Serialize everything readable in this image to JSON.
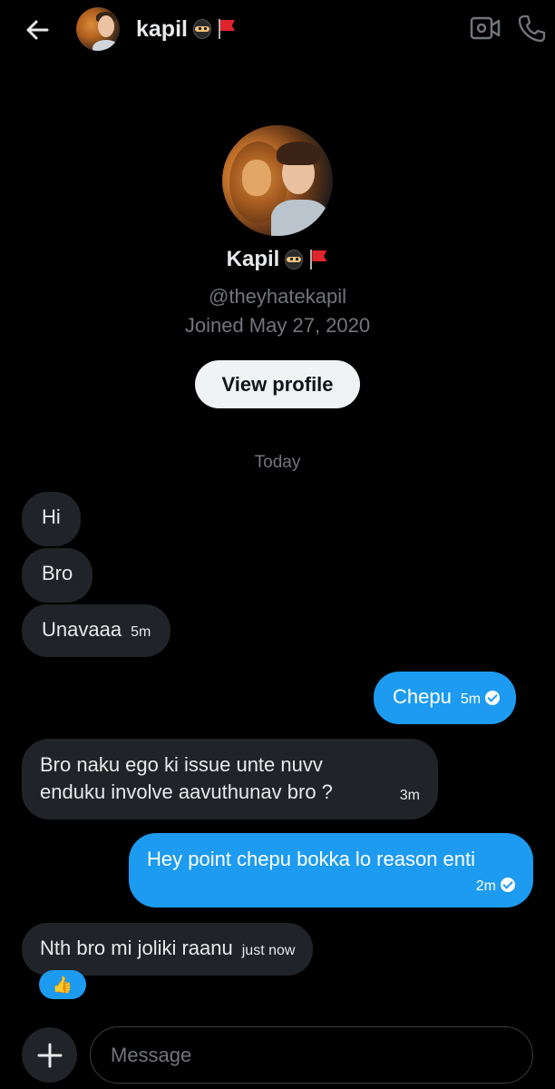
{
  "header": {
    "name": "kapil",
    "back_icon": "arrow-left-icon",
    "video_icon": "video-camera-icon",
    "call_icon": "phone-icon"
  },
  "profile": {
    "name": "Kapil",
    "handle": "@theyhatekapil",
    "joined": "Joined May 27, 2020",
    "view_profile_label": "View profile"
  },
  "date_separator": "Today",
  "messages": [
    {
      "direction": "in",
      "text": "Hi"
    },
    {
      "direction": "in",
      "text": "Bro"
    },
    {
      "direction": "in",
      "text": "Unavaaa",
      "time": "5m"
    },
    {
      "direction": "out",
      "text": "Chepu",
      "time": "5m",
      "status": "seen-check"
    },
    {
      "direction": "in",
      "text_line1": "Bro naku ego ki issue unte nuvv",
      "text_line2": "enduku involve aavuthunav bro ?",
      "time": "3m"
    },
    {
      "direction": "out",
      "text": "Hey point chepu bokka lo reason enti",
      "time": "2m",
      "status": "seen-check"
    },
    {
      "direction": "in",
      "text": "Nth bro mi joliki raanu",
      "time": "just now",
      "reaction": "👍"
    }
  ],
  "composer": {
    "placeholder": "Message",
    "add_icon": "plus-icon"
  },
  "colors": {
    "background": "#000000",
    "incoming_bubble": "#202327",
    "outgoing_bubble": "#1d9bf0",
    "secondary_text": "#71767b"
  }
}
